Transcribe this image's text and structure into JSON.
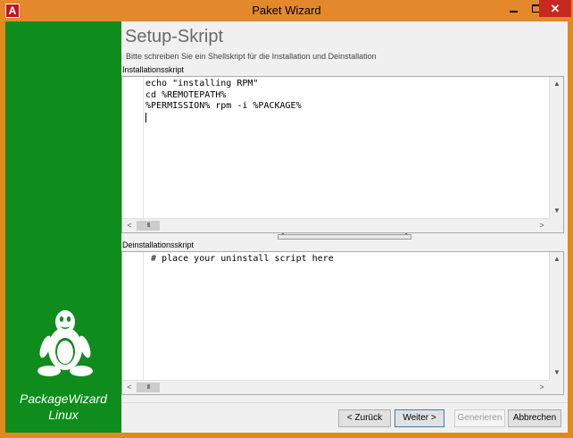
{
  "window": {
    "title": "Paket Wizard",
    "app_icon": "A",
    "close_glyph": "✕"
  },
  "sidebar": {
    "brand_line1": "PackageWizard",
    "brand_line2": "Linux",
    "background": "#0e8c1c",
    "logo_icon": "tux-penguin-icon"
  },
  "page": {
    "title": "Setup-Skript",
    "subtitle": "Bitte schreiben Sie ein Shellskript für die Installation und Deinstallation"
  },
  "install": {
    "label": "Installationsskript",
    "lines": [
      "echo \"installing RPM\"",
      "cd %REMOTEPATH%",
      "%PERMISSION% rpm -i %PACKAGE%"
    ]
  },
  "uninstall": {
    "label": "Deinstallationsskript",
    "lines": [
      " # place your uninstall script here"
    ]
  },
  "scroll": {
    "left": "<",
    "right": ">",
    "thumb": "III",
    "up": "▲",
    "down": "▼"
  },
  "splitter": {
    "left": "⌃",
    "right": "⌃"
  },
  "buttons": {
    "back": "< Zurück",
    "next": "Weiter >",
    "generate": "Generieren",
    "cancel": "Abbrechen"
  }
}
